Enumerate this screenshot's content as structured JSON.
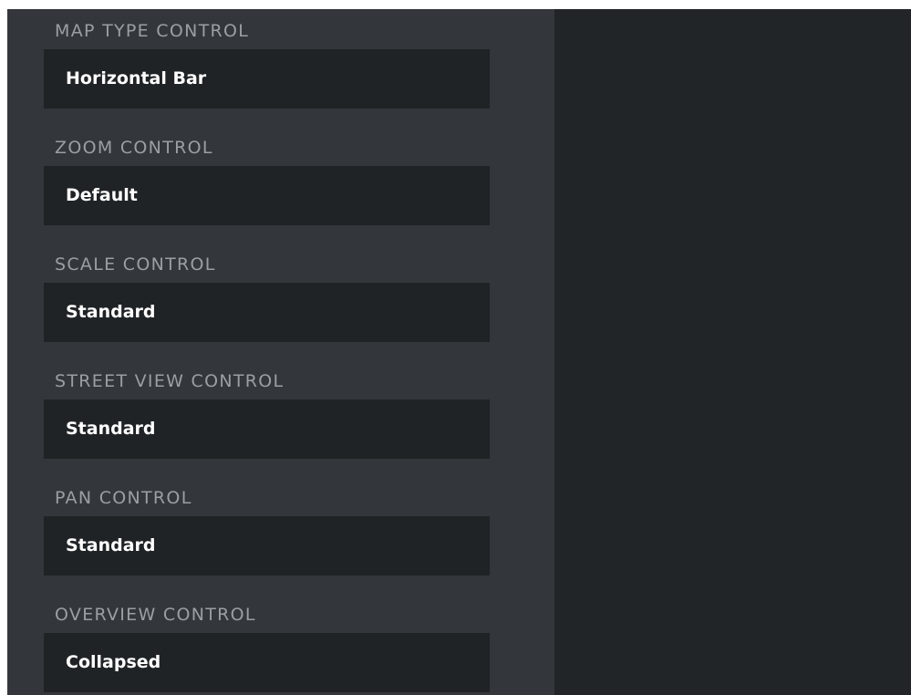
{
  "controls": [
    {
      "label": "MAP TYPE CONTROL",
      "value": "Horizontal Bar"
    },
    {
      "label": "ZOOM CONTROL",
      "value": "Default"
    },
    {
      "label": "SCALE CONTROL",
      "value": "Standard"
    },
    {
      "label": "STREET VIEW CONTROL",
      "value": "Standard"
    },
    {
      "label": "PAN CONTROL",
      "value": "Standard"
    },
    {
      "label": "OVERVIEW CONTROL",
      "value": "Collapsed"
    }
  ],
  "colors": {
    "sidebar_bg": "#33373b",
    "main_bg": "#222527",
    "select_bg": "#202325",
    "label_text": "#9b9fa3",
    "value_text": "#ffffff"
  }
}
